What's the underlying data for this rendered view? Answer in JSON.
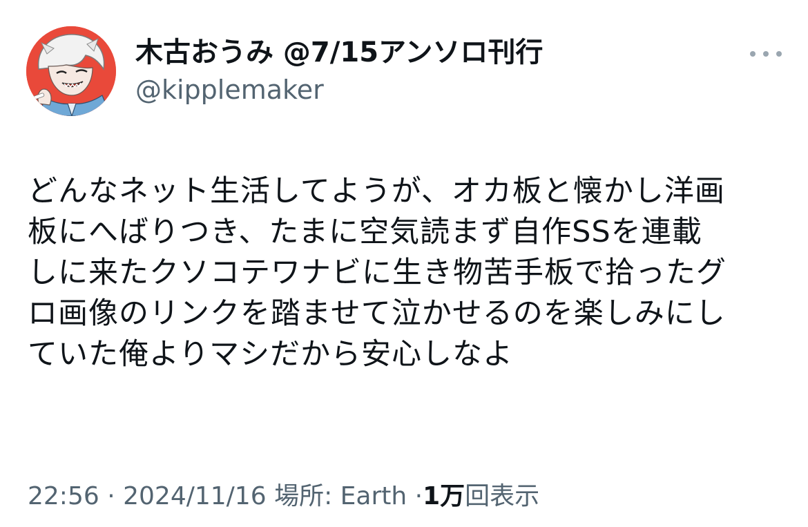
{
  "author": {
    "display_name": "木古おうみ @7/15アンソロ刊行",
    "handle": "@kipplemaker",
    "avatar_icon": "avatar-illustration",
    "avatar_bg": "#e9493a"
  },
  "more_icon": "more-horizontal-icon",
  "tweet": {
    "lines": [
      "どんなネット生活してようが、オカ板と懐かし洋画",
      "板にへばりつき、たまに空気読まず自作SSを連載",
      "しに来たクソコテワナビに生き物苦手板で拾ったグ",
      "ロ画像のリンクを踏ませて泣かせるのを楽しみにし",
      "ていた俺よりマシだから安心しなよ"
    ]
  },
  "meta": {
    "time": "22:56",
    "separator": "·",
    "date": "2024/11/16",
    "location": "場所: Earth",
    "views_count": "1万",
    "views_label": "回表示"
  },
  "colors": {
    "primary_text": "#0f1419",
    "secondary_text": "#536471",
    "more_dots": "#9aa6b0"
  }
}
